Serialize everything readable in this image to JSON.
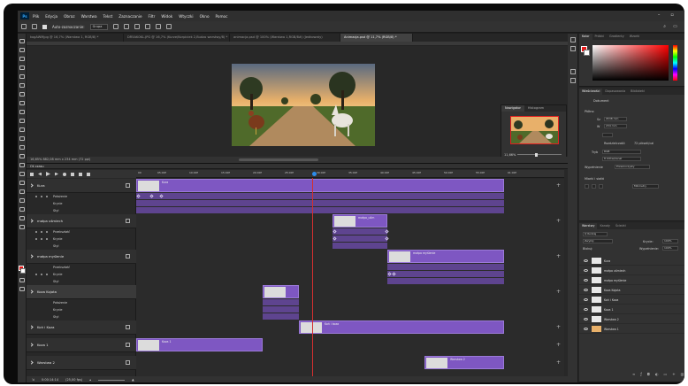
{
  "app": {
    "logo": "Ps",
    "menu": [
      "Plik",
      "Edycja",
      "Obraz",
      "Warstwa",
      "Tekst",
      "Zaznaczanie",
      "Filtr",
      "Widok",
      "Wtyczki",
      "Okno",
      "Pomoc"
    ],
    "window_controls": [
      "–",
      "▫",
      "×"
    ]
  },
  "options_bar": {
    "auto_select_label": "Auto-zaznaczanie:",
    "auto_select_value": "Grupa",
    "right_icons": [
      "search-icon",
      "workspace-icon",
      "share-icon"
    ]
  },
  "doc_tabs": [
    {
      "label": "kogAWMjpg @ 16,7% (Warstwa 1, RGB/8) *",
      "active": false
    },
    {
      "label": "DR5AK0KL.JPG @ 16,7% (Kurze/Korpiciek 2,Budzo warstwy/8) *",
      "active": false
    },
    {
      "label": "animacja.psd @ 100% (Warstwa 1,RGB/8#) (Jedkowaty)",
      "active": false
    },
    {
      "label": "Animacja.psd @ 11,7% (RGB/8) *",
      "active": true
    }
  ],
  "canvas": {
    "status": "16,65%    882,08 mm x 234 mm (72 ppi)"
  },
  "navigator": {
    "tabs": [
      "Nawigator",
      "Histogram"
    ],
    "zoom": "11,66%"
  },
  "timeline": {
    "title": "Oś czasu",
    "ruler_ticks": [
      "00",
      "05:00f",
      "10:00f",
      "15:00f",
      "20:00f",
      "25:00f",
      "30:00f",
      "35:00f",
      "40:00f",
      "45:00f",
      "50:00f",
      "55:00f",
      "01:00f"
    ],
    "playhead_value": "37:12f",
    "footer_time": "0:00:14:14",
    "footer_fps": "(25,00 fps)",
    "layers": [
      {
        "name": "Kura",
        "props": [
          "Położenie",
          "Krycie",
          "Styl"
        ],
        "clip_label": "Kura"
      },
      {
        "name": "małpa uśmiech",
        "props": [
          "Przekształć",
          "Krycie",
          "Styl"
        ],
        "clip_label": "małpa_uśm"
      },
      {
        "name": "małpa myślenie",
        "props": [
          "Przekształć",
          "Krycie",
          "Styl"
        ],
        "clip_label": "małpa myślenie"
      },
      {
        "name": "Koza Kojota",
        "props": [
          "Położenie",
          "Krycie",
          "Styl"
        ],
        "clip_label": ""
      },
      {
        "name": "Koń i Koza",
        "props": [],
        "clip_label": "Koń i koza"
      },
      {
        "name": "Koza 1",
        "props": [],
        "clip_label": "Koza 1"
      },
      {
        "name": "Warstwa 2",
        "props": [],
        "clip_label": "Warstwa 2"
      }
    ]
  },
  "right_dock": {
    "color_tabs": [
      "Kolor",
      "Próbki",
      "Gradienty",
      "Wzorki"
    ],
    "color": {
      "foreground": "#e81919",
      "background": "#ffffff"
    },
    "props_tabs": [
      "Właściwości",
      "Dopasowania",
      "Biblioteki"
    ],
    "props_doc": "Dokument",
    "canvas_section": "Płótno",
    "width_label": "Sz",
    "width_value": "9538 mm",
    "height_label": "W",
    "height_value": "234 mm",
    "res_label": "Rozdzielczość:",
    "res_value": "72 pikseli/cal",
    "mode_label": "Tryb",
    "mode_value": "RGB",
    "bits_value": "8 bitów/kanał",
    "fill_label": "Wypełnienie",
    "fill_value": "Przezroczysty",
    "grid_section": "Miarki i siatki",
    "units_value": "Milimetry",
    "layers_tabs": [
      "Warstwy",
      "Kanały",
      "Ścieżki"
    ],
    "layers_search": "Q Rodzaj",
    "blend": "Zwykły",
    "opacity_label": "Krycie:",
    "opacity_value": "100%",
    "lock_label": "Blokuj:",
    "fill_short_label": "Wypełnienie:",
    "fill_short_value": "100%",
    "layer_list": [
      "Kura",
      "małpa uśmiech",
      "małpa myślenie",
      "Koza Kojota",
      "Koń i Koza",
      "Koza 1",
      "Warstwa 2",
      "Warstwa 1"
    ]
  }
}
